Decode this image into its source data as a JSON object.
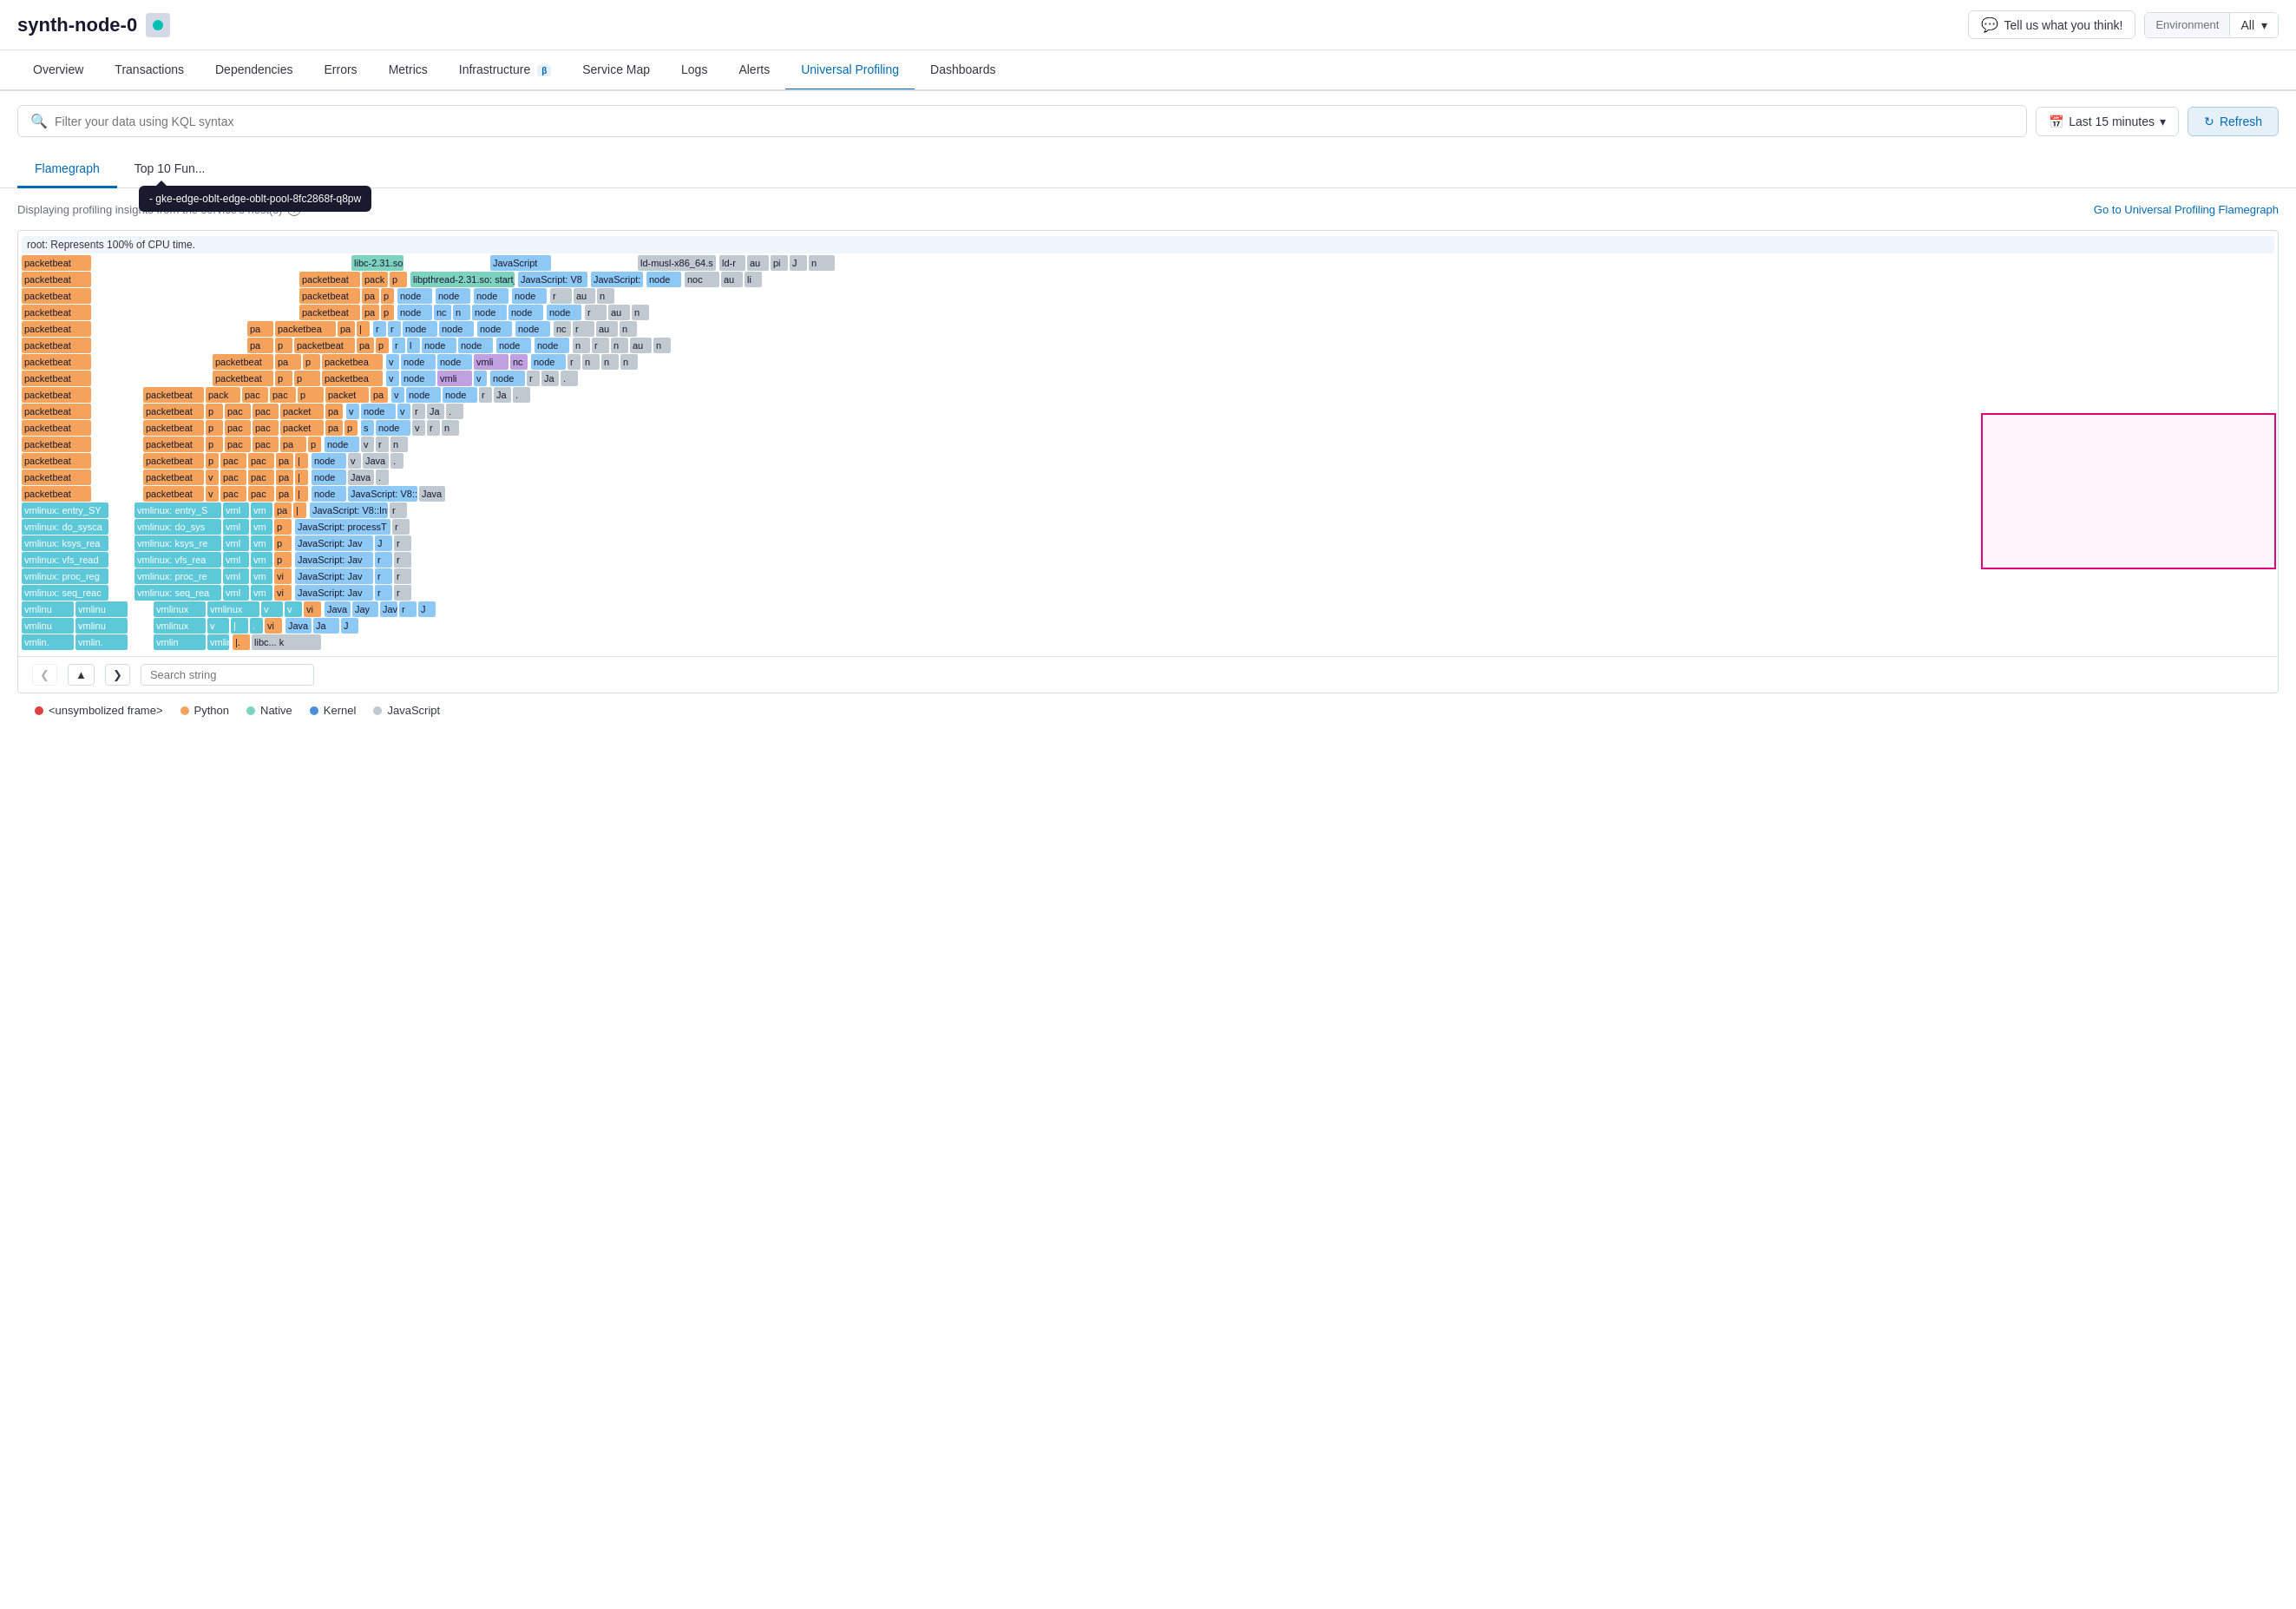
{
  "header": {
    "title": "synth-node-0",
    "status": "green",
    "feedback_btn": "Tell us what you think!",
    "env_label": "Environment",
    "env_value": "All",
    "chevron": "▾"
  },
  "nav": {
    "tabs": [
      {
        "label": "Overview",
        "active": false,
        "beta": false
      },
      {
        "label": "Transactions",
        "active": false,
        "beta": false
      },
      {
        "label": "Dependencies",
        "active": false,
        "beta": false
      },
      {
        "label": "Errors",
        "active": false,
        "beta": false
      },
      {
        "label": "Metrics",
        "active": false,
        "beta": false
      },
      {
        "label": "Infrastructure",
        "active": false,
        "beta": true
      },
      {
        "label": "Service Map",
        "active": false,
        "beta": false
      },
      {
        "label": "Logs",
        "active": false,
        "beta": false
      },
      {
        "label": "Alerts",
        "active": false,
        "beta": false
      },
      {
        "label": "Universal Profiling",
        "active": true,
        "beta": false
      },
      {
        "label": "Dashboards",
        "active": false,
        "beta": false
      }
    ]
  },
  "toolbar": {
    "search_placeholder": "Filter your data using KQL syntax",
    "search_value": "",
    "time_label": "Last 15 minutes",
    "refresh_label": "Refresh"
  },
  "sub_tabs": {
    "tabs": [
      {
        "label": "Flamegraph",
        "active": true
      },
      {
        "label": "Top 10 Fun...",
        "active": false
      }
    ],
    "tooltip": "- gke-edge-oblt-edge-oblt-pool-8fc2868f-q8pw"
  },
  "profiling": {
    "info_text": "Displaying profiling insights from the service's host(s)",
    "universal_link": "Go to Universal Profiling Flamegraph"
  },
  "flamegraph": {
    "root_label": "root: Represents 100% of CPU time.",
    "nav_search_placeholder": "Search string"
  },
  "legend": {
    "items": [
      {
        "label": "<unsymbolized frame>",
        "color": "#e04040"
      },
      {
        "label": "Python",
        "color": "#f5a35c"
      },
      {
        "label": "Native",
        "color": "#7dd3c0"
      },
      {
        "label": "Kernel",
        "color": "#4a90d9"
      },
      {
        "label": "JavaScript",
        "color": "#c0c8d0"
      }
    ]
  }
}
